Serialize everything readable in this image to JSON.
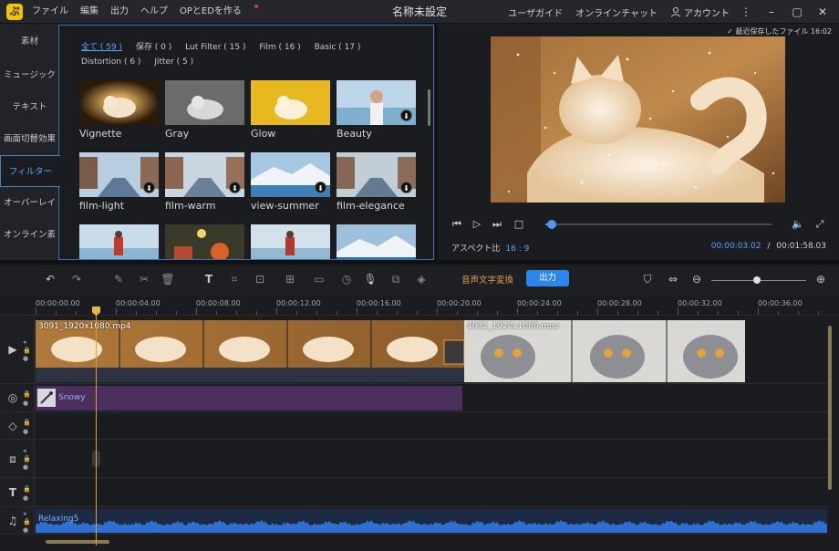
{
  "titlebar": {
    "logo": "ぷ",
    "menu": [
      "ファイル",
      "編集",
      "出力",
      "ヘルプ",
      "OPとEDを作る"
    ],
    "title": "名称未設定",
    "user_guide": "ユーザガイド",
    "online_chat": "オンラインチャット",
    "account": "アカウント"
  },
  "leftnav": [
    "素材",
    "ミュージック",
    "テキスト",
    "画面切替効果",
    "フィルター",
    "オーバーレイ",
    "オンライン素材"
  ],
  "filters": {
    "tabs": [
      "全て ( 59 )",
      "保存 ( 0 )",
      "Lut Filter ( 15 )",
      "Film ( 16 )",
      "Basic ( 17 )",
      "Distortion ( 6 )",
      "Jitter ( 5 )"
    ],
    "tiles": [
      "Vignette",
      "Gray",
      "Glow",
      "Beauty",
      "film-light",
      "film-warm",
      "view-summer",
      "film-elegance"
    ]
  },
  "preview": {
    "saved": "最近保存したファイル 16:02",
    "aspect_label": "アスペクト比",
    "aspect_value": "16 : 9",
    "current_time": "00:00:03.02",
    "separator": "/",
    "total_time": "00:01:58.03",
    "progress_fraction": 0.03
  },
  "toolbar": {
    "speech_to_text": "音声文字変換",
    "export": "出力"
  },
  "ruler": [
    "00:00:00.00",
    "00:00:04.00",
    "00:00:08.00",
    "00:00:12.00",
    "00:00:16.00",
    "00:00:20.00",
    "00:00:24.00",
    "00:00:28.00",
    "00:00:32.00",
    "00:00:36.00"
  ],
  "tracks": {
    "clip1": "3091_1920x1080.mp4",
    "clip2": "4032_1920x1080.mov",
    "effect": "Snowy",
    "audio": "Relaxing5"
  },
  "colors": {
    "accent": "#58a6ff",
    "export_button": "#2a86e8",
    "effect_clip": "#4a2f5c",
    "audio_wave": "#2f6fcf",
    "playhead": "#e0a030"
  }
}
